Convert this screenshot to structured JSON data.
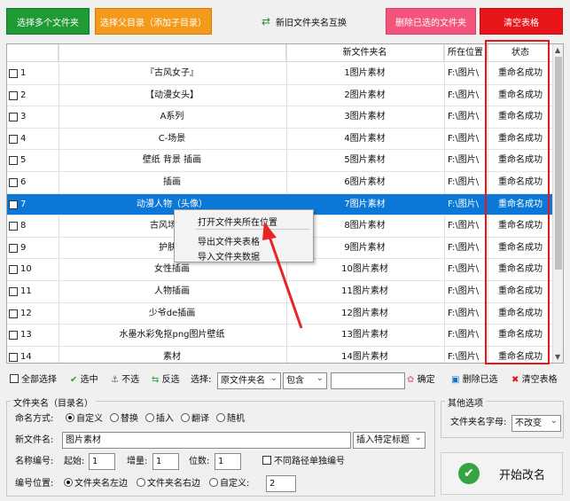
{
  "toolbar": {
    "select_folders": "选择多个文件夹",
    "select_parent": "选择父目录（添加子目录）",
    "swap": "新旧文件夹名互换",
    "delete_selected": "删除已选的文件夹",
    "clear_table": "清空表格"
  },
  "table": {
    "headers": [
      "",
      "",
      "新文件夹名",
      "所在位置",
      "状态"
    ],
    "rows": [
      {
        "num": "1",
        "orig": "『古风女子』",
        "new": "1图片素材",
        "loc": "F:\\图片\\",
        "status": "重命名成功"
      },
      {
        "num": "2",
        "orig": "【动漫女头】",
        "new": "2图片素材",
        "loc": "F:\\图片\\",
        "status": "重命名成功"
      },
      {
        "num": "3",
        "orig": "A系列",
        "new": "3图片素材",
        "loc": "F:\\图片\\",
        "status": "重命名成功"
      },
      {
        "num": "4",
        "orig": "C-场景",
        "new": "4图片素材",
        "loc": "F:\\图片\\",
        "status": "重命名成功"
      },
      {
        "num": "5",
        "orig": "壁纸  背景  插画",
        "new": "5图片素材",
        "loc": "F:\\图片\\",
        "status": "重命名成功"
      },
      {
        "num": "6",
        "orig": "插画",
        "new": "6图片素材",
        "loc": "F:\\图片\\",
        "status": "重命名成功"
      },
      {
        "num": "7",
        "orig": "动漫人物（头像）",
        "new": "7图片素材",
        "loc": "F:\\图片\\",
        "status": "重命名成功"
      },
      {
        "num": "8",
        "orig": "古风场景图",
        "new": "8图片素材",
        "loc": "F:\\图片\\",
        "status": "重命名成功"
      },
      {
        "num": "9",
        "orig": "护肤元",
        "new": "9图片素材",
        "loc": "F:\\图片\\",
        "status": "重命名成功"
      },
      {
        "num": "10",
        "orig": "女性插画",
        "new": "10图片素材",
        "loc": "F:\\图片\\",
        "status": "重命名成功"
      },
      {
        "num": "11",
        "orig": "人物插画",
        "new": "11图片素材",
        "loc": "F:\\图片\\",
        "status": "重命名成功"
      },
      {
        "num": "12",
        "orig": "少爷de插画",
        "new": "12图片素材",
        "loc": "F:\\图片\\",
        "status": "重命名成功"
      },
      {
        "num": "13",
        "orig": "水墨水彩免抠png图片壁纸",
        "new": "13图片素材",
        "loc": "F:\\图片\\",
        "status": "重命名成功"
      },
      {
        "num": "14",
        "orig": "素材",
        "new": "14图片素材",
        "loc": "F:\\图片\\",
        "status": "重命名成功"
      }
    ],
    "selected_row": 6
  },
  "context_menu": {
    "open_location": "打开文件夹所在位置",
    "export_table": "导出文件夹表格",
    "import_data": "导入文件夹数据"
  },
  "select_bar": {
    "select_all": "全部选择",
    "select": "选中",
    "unselect": "不选",
    "invert": "反选",
    "choose_label": "选择:",
    "field_value": "原文件夹名",
    "match_value": "包含",
    "search_value": "",
    "confirm": "确定",
    "delete_selected": "删除已选",
    "clear_table": "清空表格"
  },
  "rename_group": {
    "title": "文件夹名（目录名）",
    "mode_label": "命名方式:",
    "modes": [
      "自定义",
      "替换",
      "插入",
      "翻译",
      "随机"
    ],
    "mode_selected": 0,
    "new_name_label": "新文件名:",
    "new_name_value": "图片素材",
    "insert_title_label": "插入特定标题",
    "numbering_label": "名称编号:",
    "start_label": "起始:",
    "start_value": "1",
    "step_label": "增量:",
    "step_value": "1",
    "digits_label": "位数:",
    "digits_value": "1",
    "separate_numbering": "不同路径单独编号",
    "position_label": "编号位置:",
    "positions": [
      "文件夹名左边",
      "文件夹名右边",
      "自定义:"
    ],
    "position_selected": 0,
    "custom_value": "2"
  },
  "other_group": {
    "title": "其他选项",
    "case_label": "文件夹名字母:",
    "case_value": "不改变"
  },
  "start_button": "开始改名",
  "colors": {
    "green": "#1f9a35",
    "orange": "#f39a1a",
    "pink": "#f2547b",
    "red": "#e8161a",
    "selection": "#0b78d7"
  }
}
